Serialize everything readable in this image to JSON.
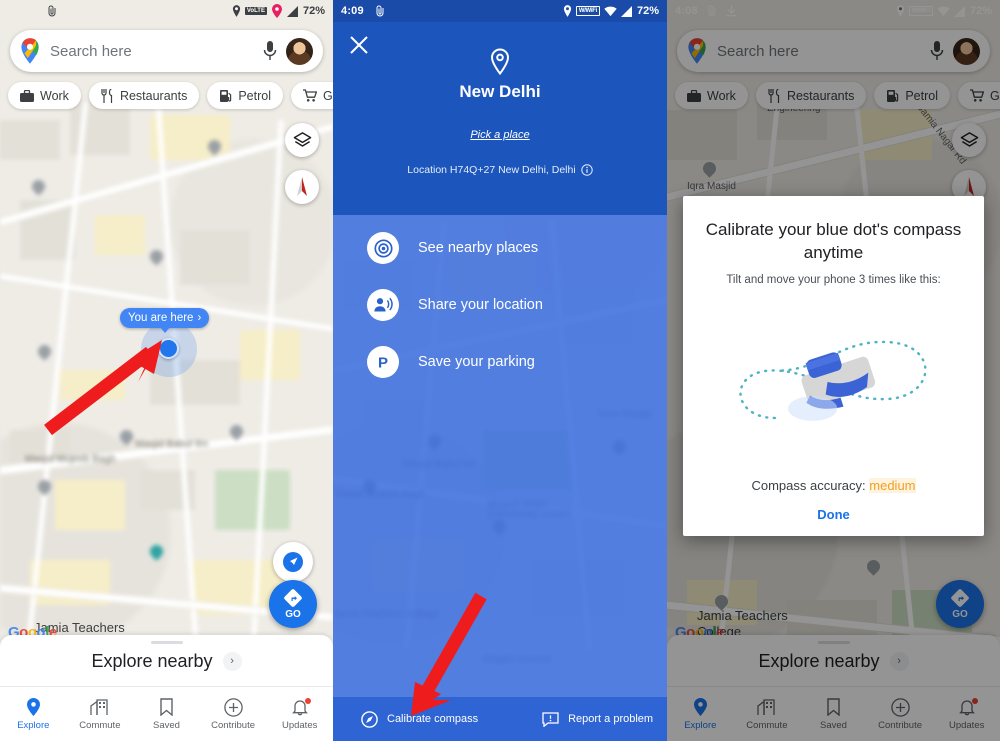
{
  "panels": {
    "left": {
      "status": {
        "time": "",
        "battery": "72%",
        "network": "VoLTE"
      },
      "search": {
        "placeholder": "Search here",
        "mic": "mic-icon",
        "avatar": "user-avatar"
      },
      "chips": [
        {
          "label": "Work",
          "icon": "briefcase-icon"
        },
        {
          "label": "Restaurants",
          "icon": "restaurant-icon"
        },
        {
          "label": "Petrol",
          "icon": "fuel-icon"
        },
        {
          "label": "Groceries",
          "icon": "cart-icon"
        }
      ],
      "map": {
        "callout": "You are here",
        "watermark": [
          "G",
          "o",
          "o",
          "g",
          "l",
          "e"
        ],
        "labels": [
          "Jamia Teachers College",
          "Masjid Babul Ilm",
          "Masjid Mujeeb Bagh"
        ]
      },
      "buttons": {
        "layers": "layers-icon",
        "compass": "compass-needle-icon",
        "locate": "my-location-icon",
        "go": "GO"
      },
      "sheet": {
        "title": "Explore nearby",
        "chevron": "›"
      },
      "nav": [
        {
          "label": "Explore",
          "icon": "location-pin-icon",
          "active": true
        },
        {
          "label": "Commute",
          "icon": "commute-icon",
          "active": false
        },
        {
          "label": "Saved",
          "icon": "bookmark-icon",
          "active": false
        },
        {
          "label": "Contribute",
          "icon": "plus-circle-icon",
          "active": false
        },
        {
          "label": "Updates",
          "icon": "bell-icon",
          "active": false,
          "badge": true
        }
      ]
    },
    "middle": {
      "status": {
        "time": "4:09",
        "battery": "72%",
        "network": "W/WiFi"
      },
      "close": "close-icon",
      "pin": "location-pin-icon",
      "title": "New Delhi",
      "pick_a_place": "Pick a place",
      "location_code": "Location H74Q+27 New Delhi, Delhi",
      "info_icon": "info-icon",
      "actions": [
        {
          "label": "See nearby places",
          "icon": "nearby-places-icon"
        },
        {
          "label": "Share your location",
          "icon": "share-location-icon"
        },
        {
          "label": "Save your parking",
          "icon": "parking-icon"
        }
      ],
      "bottom": [
        {
          "label": "Calibrate compass",
          "icon": "compass-icon"
        },
        {
          "label": "Report a problem",
          "icon": "report-problem-icon"
        }
      ],
      "map_labels": [
        "Masjid Babul Ilm",
        "Masjid Mujeeb Bagh",
        "Mujeeb Bagh Community Centre",
        "Noor Masjid",
        "Jamia Teachers College",
        "Eidgah Ground"
      ]
    },
    "right": {
      "status": {
        "time": "4:08",
        "battery": "72%",
        "network": "W/WiFi"
      },
      "search": {
        "placeholder": "Search here",
        "mic": "mic-icon",
        "avatar": "user-avatar"
      },
      "chips": [
        {
          "label": "Work",
          "icon": "briefcase-icon"
        },
        {
          "label": "Restaurants",
          "icon": "restaurant-icon"
        },
        {
          "label": "Petrol",
          "icon": "fuel-icon"
        },
        {
          "label": "Groceries",
          "icon": "cart-icon"
        }
      ],
      "map": {
        "watermark": [
          "G",
          "o",
          "o",
          "g",
          "l",
          "e"
        ],
        "labels": [
          "Iqra Masjid",
          "Engineering",
          "Jamia Teachers College",
          "Jamia Nagar Rd"
        ]
      },
      "dialog": {
        "title": "Calibrate your blue dot's compass anytime",
        "subtitle": "Tilt and move your phone 3 times like this:",
        "accuracy_label": "Compass accuracy:",
        "accuracy_value": "medium",
        "done": "Done",
        "art": "figure-eight-phone-tilt-animation"
      },
      "buttons": {
        "layers": "layers-icon",
        "compass": "compass-needle-icon",
        "go": "GO"
      },
      "sheet": {
        "title": "Explore nearby",
        "chevron": "›"
      },
      "nav": [
        {
          "label": "Explore",
          "icon": "location-pin-icon",
          "active": true
        },
        {
          "label": "Commute",
          "icon": "commute-icon",
          "active": false
        },
        {
          "label": "Saved",
          "icon": "bookmark-icon",
          "active": false
        },
        {
          "label": "Contribute",
          "icon": "plus-circle-icon",
          "active": false
        },
        {
          "label": "Updates",
          "icon": "bell-icon",
          "active": false,
          "badge": true
        }
      ]
    }
  },
  "annotations": {
    "arrows": [
      {
        "name": "arrow-to-blue-dot",
        "color": "#ee1c1c"
      },
      {
        "name": "arrow-to-calibrate-compass",
        "color": "#ee1c1c"
      }
    ]
  },
  "colors": {
    "google_blue": "#1a73e8",
    "sheet_blue": "#1c56bd",
    "scrim_blue": "#3c6ede",
    "accent_amber": "#f0a020",
    "arrow_red": "#ee1c1c"
  }
}
